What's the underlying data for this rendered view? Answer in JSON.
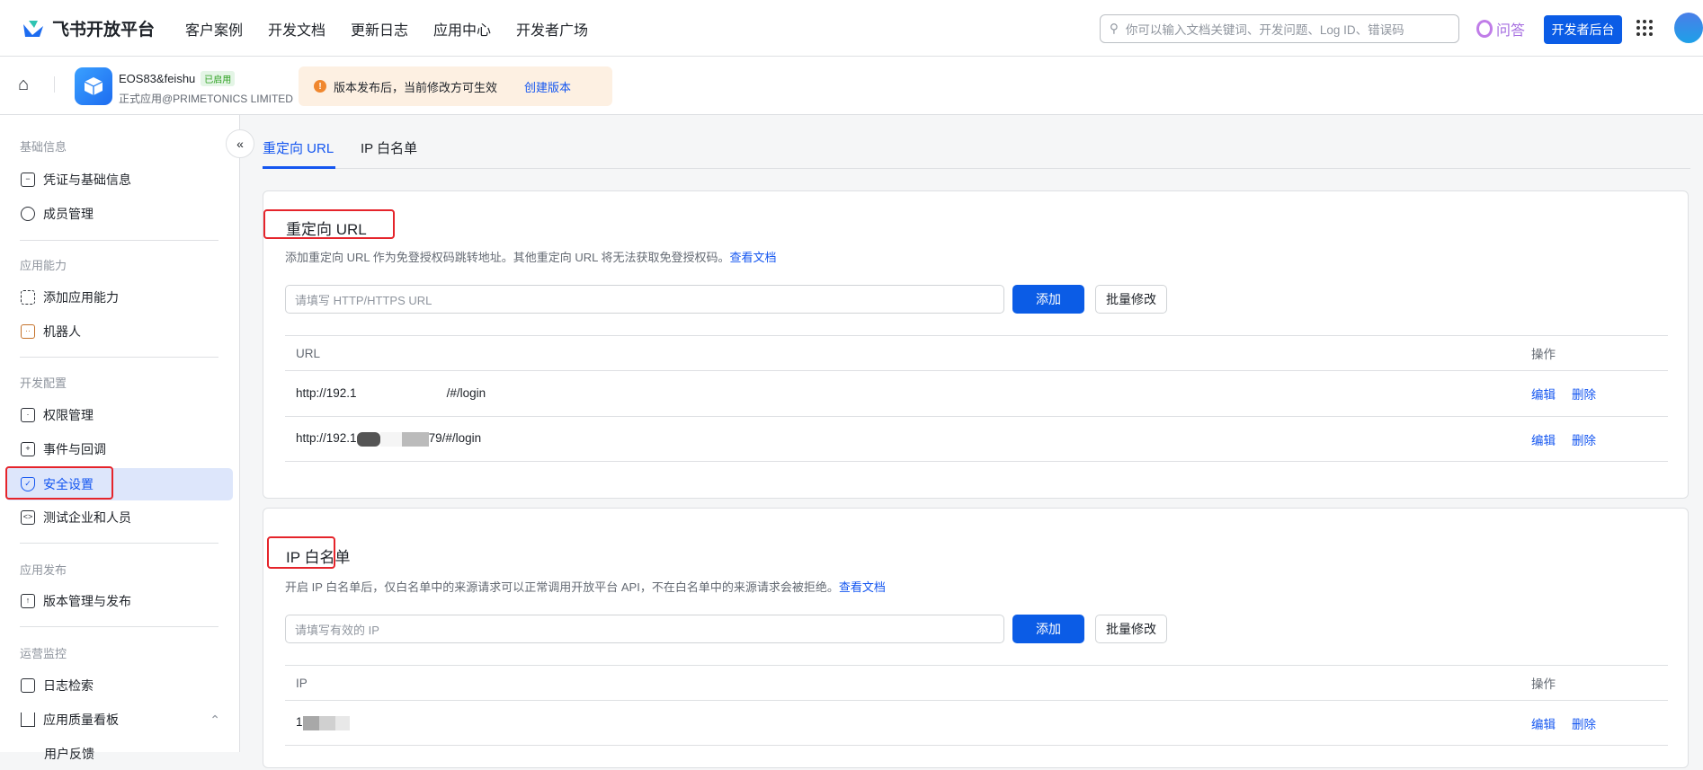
{
  "topbar": {
    "brand": "飞书开放平台",
    "nav": [
      "客户案例",
      "开发文档",
      "更新日志",
      "应用中心",
      "开发者广场"
    ],
    "search_placeholder": "你可以输入文档关键词、开发问题、Log ID、错误码",
    "qa": "问答",
    "dev_console": "开发者后台"
  },
  "app": {
    "name": "EOS83&feishu",
    "status": "已启用",
    "subtitle": "正式应用@PRIMETONICS LIMITED",
    "notice": "版本发布后，当前修改方可生效",
    "notice_action": "创建版本"
  },
  "sidebar": {
    "groups": [
      {
        "title": "基础信息",
        "items": [
          "凭证与基础信息",
          "成员管理"
        ]
      },
      {
        "title": "应用能力",
        "items": [
          "添加应用能力",
          "机器人"
        ]
      },
      {
        "title": "开发配置",
        "items": [
          "权限管理",
          "事件与回调",
          "安全设置",
          "测试企业和人员"
        ]
      },
      {
        "title": "应用发布",
        "items": [
          "版本管理与发布"
        ]
      },
      {
        "title": "运营监控",
        "items": [
          "日志检索",
          "应用质量看板",
          "用户反馈"
        ]
      }
    ],
    "active": "安全设置"
  },
  "tabs": [
    "重定向 URL",
    "IP 白名单"
  ],
  "redirect": {
    "title": "重定向 URL",
    "desc": "添加重定向 URL 作为免登授权码跳转地址。其他重定向 URL 将无法获取免登授权码。",
    "doc_link": "查看文档",
    "placeholder": "请填写 HTTP/HTTPS URL",
    "add": "添加",
    "bulk": "批量修改",
    "col_url": "URL",
    "col_ops": "操作",
    "rows": [
      {
        "prefix": "http://192.1",
        "suffix": "/#/login"
      },
      {
        "prefix": "http://192.1",
        "suffix": "79/#/login"
      }
    ],
    "edit": "编辑",
    "delete": "删除"
  },
  "ip": {
    "title": "IP 白名单",
    "desc": "开启 IP 白名单后，仅白名单中的来源请求可以正常调用开放平台 API，不在白名单中的来源请求会被拒绝。",
    "doc_link": "查看文档",
    "placeholder": "请填写有效的 IP",
    "add": "添加",
    "bulk": "批量修改",
    "col_ip": "IP",
    "col_ops": "操作",
    "rows": [
      {
        "prefix": "1",
        "suffix": ""
      }
    ],
    "edit": "编辑",
    "delete": "删除"
  }
}
